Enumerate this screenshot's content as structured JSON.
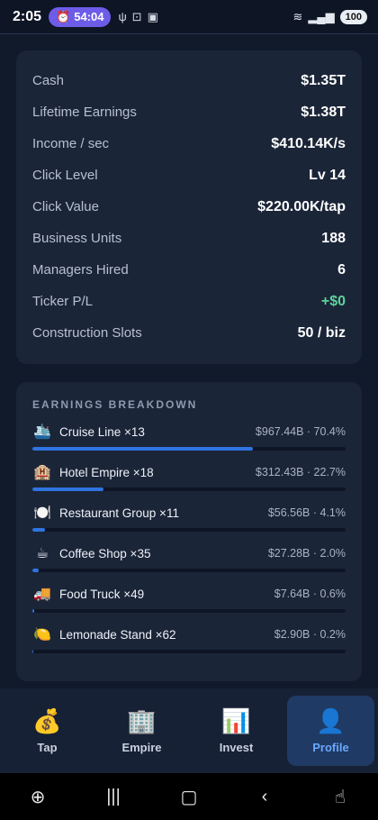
{
  "status_bar": {
    "time": "2:05",
    "timer": "54:04",
    "battery": "100"
  },
  "stats": [
    {
      "label": "Cash",
      "value": "$1.35T"
    },
    {
      "label": "Lifetime Earnings",
      "value": "$1.38T"
    },
    {
      "label": "Income / sec",
      "value": "$410.14K/s"
    },
    {
      "label": "Click Level",
      "value": "Lv 14"
    },
    {
      "label": "Click Value",
      "value": "$220.00K/tap"
    },
    {
      "label": "Business Units",
      "value": "188"
    },
    {
      "label": "Managers Hired",
      "value": "6"
    },
    {
      "label": "Ticker P/L",
      "value": "+$0"
    },
    {
      "label": "Construction Slots",
      "value": "50 / biz"
    }
  ],
  "earnings": {
    "title": "EARNINGS BREAKDOWN",
    "items": [
      {
        "emoji": "🛳️",
        "name": "Cruise Line ×13",
        "value": "$967.44B · 70.4%",
        "share": 70.4
      },
      {
        "emoji": "🏨",
        "name": "Hotel Empire ×18",
        "value": "$312.43B · 22.7%",
        "share": 22.7
      },
      {
        "emoji": "🍽️",
        "name": "Restaurant Group ×11",
        "value": "$56.56B · 4.1%",
        "share": 4.1
      },
      {
        "emoji": "☕",
        "name": "Coffee Shop ×35",
        "value": "$27.28B · 2.0%",
        "share": 2.0
      },
      {
        "emoji": "🚚",
        "name": "Food Truck ×49",
        "value": "$7.64B · 0.6%",
        "share": 0.6
      },
      {
        "emoji": "🍋",
        "name": "Lemonade Stand ×62",
        "value": "$2.90B · 0.2%",
        "share": 0.2
      }
    ]
  },
  "nav": {
    "tap": {
      "icon": "💰",
      "label": "Tap"
    },
    "empire": {
      "icon": "🏢",
      "label": "Empire"
    },
    "invest": {
      "icon": "📊",
      "label": "Invest"
    },
    "profile": {
      "icon": "👤",
      "label": "Profile"
    }
  },
  "colors": {
    "accent": "#2f74e0",
    "positive": "#5ed39a",
    "active_tab_bg": "#1f3a64",
    "active_tab_text": "#6aa8ff"
  }
}
